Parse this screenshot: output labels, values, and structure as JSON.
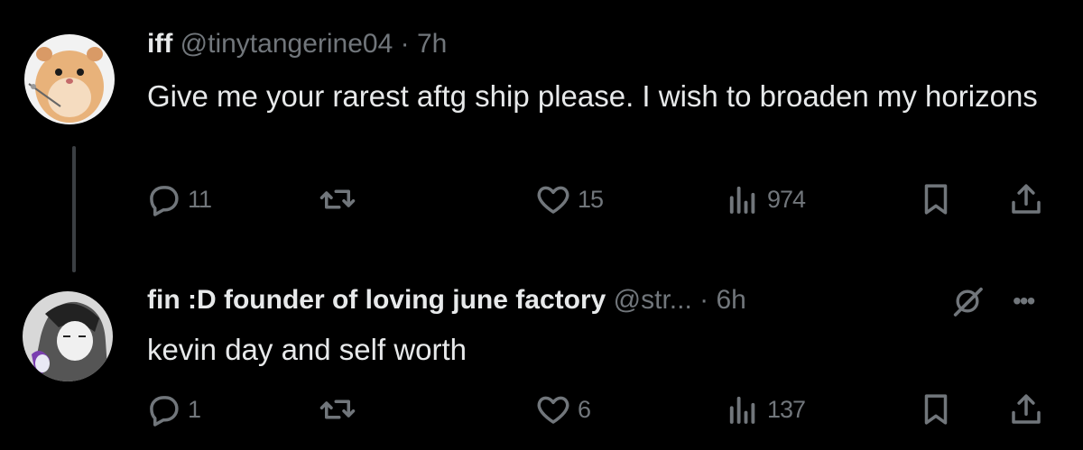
{
  "tweets": [
    {
      "display_name": "iff",
      "handle": "@tinytangerine04",
      "time": "· 7h",
      "text": "Give me your rarest aftg ship please. I wish to broaden my horizons",
      "replies": "11",
      "retweets": "",
      "likes": "15",
      "views": "974",
      "avatar": "hamster-avatar"
    },
    {
      "display_name": "fin :D founder of loving june factory",
      "handle": "@str...",
      "time": "· 6h",
      "text": "kevin day and self worth",
      "replies": "1",
      "retweets": "",
      "likes": "6",
      "views": "137",
      "avatar": "manga-avatar"
    }
  ],
  "icons": {
    "reply": "reply-icon",
    "retweet": "retweet-icon",
    "like": "heart-icon",
    "views": "views-icon",
    "bookmark": "bookmark-icon",
    "share": "share-icon",
    "grok": "grok-icon",
    "more": "more-icon"
  },
  "more_label": "•••",
  "colors": {
    "background": "#000000",
    "primary_text": "#e7e9ea",
    "secondary_text": "#71767b",
    "thread_line": "#3b3f43"
  }
}
